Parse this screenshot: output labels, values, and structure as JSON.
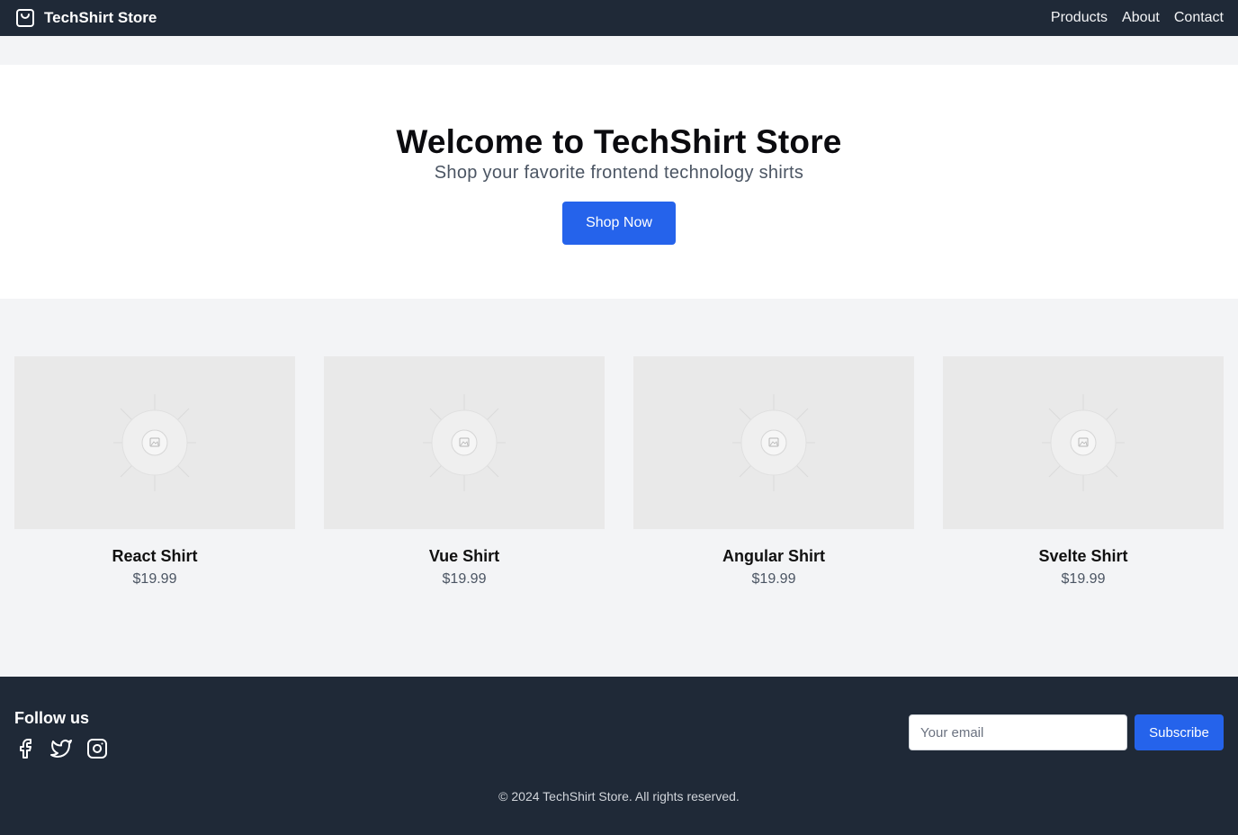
{
  "navbar": {
    "brand": "TechShirt Store",
    "brand_icon": "shopping-bag-icon",
    "links": [
      "Products",
      "About",
      "Contact"
    ]
  },
  "hero": {
    "title": "Welcome to TechShirt Store",
    "subtitle": "Shop your favorite frontend technology shirts",
    "cta": "Shop Now"
  },
  "products": [
    {
      "name": "React Shirt",
      "price": "$19.99",
      "image_icon": "image-placeholder-icon"
    },
    {
      "name": "Vue Shirt",
      "price": "$19.99",
      "image_icon": "image-placeholder-icon"
    },
    {
      "name": "Angular Shirt",
      "price": "$19.99",
      "image_icon": "image-placeholder-icon"
    },
    {
      "name": "Svelte Shirt",
      "price": "$19.99",
      "image_icon": "image-placeholder-icon"
    }
  ],
  "footer": {
    "follow_title": "Follow us",
    "socials": [
      "facebook-icon",
      "twitter-icon",
      "instagram-icon"
    ],
    "email_placeholder": "Your email",
    "subscribe_label": "Subscribe",
    "copyright": "© 2024 TechShirt Store. All rights reserved."
  },
  "colors": {
    "nav_bg": "#1f2937",
    "accent": "#2563eb",
    "page_bg": "#f3f4f6",
    "hero_bg": "#ffffff"
  }
}
